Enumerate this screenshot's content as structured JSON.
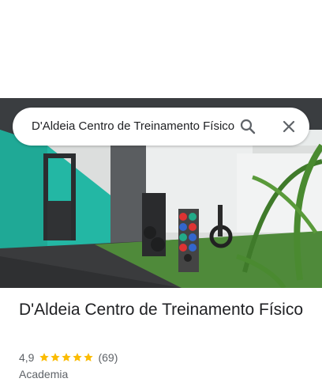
{
  "search": {
    "query": "D'Aldeia Centro de Treinamento Físico"
  },
  "place": {
    "name": "D'Aldeia Centro de Treinamento Físico",
    "rating": "4,9",
    "stars": 5,
    "review_count": "(69)",
    "category": "Academia"
  },
  "icons": {
    "search": "search-icon",
    "close": "close-icon",
    "star": "star-icon"
  },
  "colors": {
    "star": "#fbbc04",
    "text_primary": "#202124",
    "text_secondary": "#5f6368",
    "icon": "#5f6368"
  }
}
